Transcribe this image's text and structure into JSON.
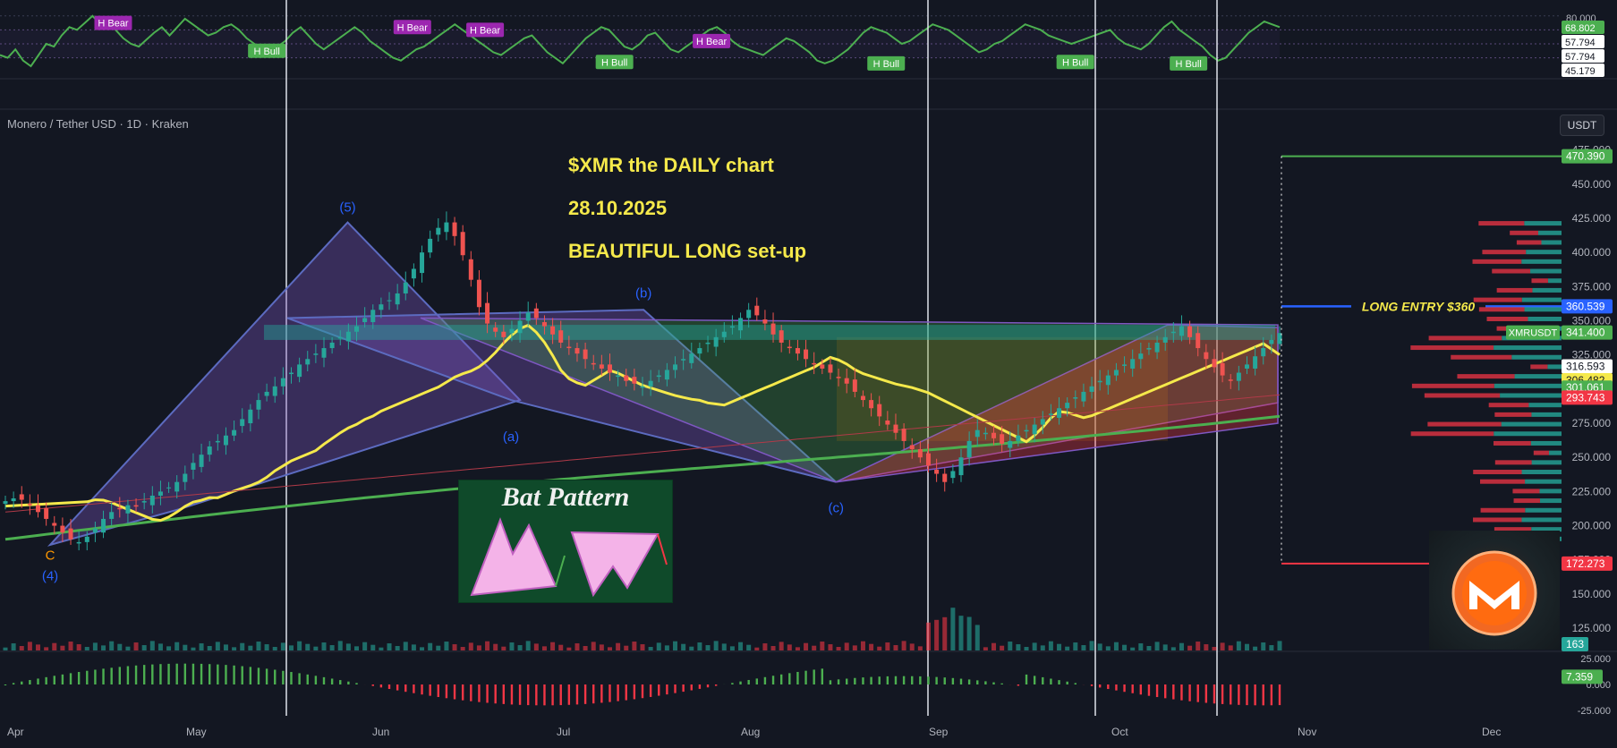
{
  "header": {
    "symbol": "Monero / Tether USD · 1D · Kraken",
    "currency_button": "USDT"
  },
  "annotations": {
    "line1": "$XMR   the DAILY chart",
    "line2": "28.10.2025",
    "line3": "BEAUTIFUL LONG set-up",
    "entry_label": "LONG ENTRY $360",
    "bat_title": "Bat Pattern"
  },
  "colors": {
    "background": "#131722",
    "rsi_line": "#4caf50",
    "bull_badge": "#4caf50",
    "bear_badge": "#9c27b0",
    "up_candle": "#26a69a",
    "down_candle": "#ef5350",
    "ma_yellow": "#f5e94b",
    "ma_green": "#4caf50",
    "entry_blue": "#2962ff",
    "target_green": "#4caf50",
    "stop_red": "#f23645",
    "harmonic_fill": "#7e57c2"
  },
  "chart_data": [
    {
      "type": "line",
      "title": "",
      "panel": "rsi",
      "y_ticks": [
        "80.000"
      ],
      "price_labels": [
        {
          "text": "68.802",
          "color": "#4caf50"
        },
        {
          "text": "57.794",
          "color": "#ffffff"
        },
        {
          "text": "57.794",
          "color": "#ffffff"
        },
        {
          "text": "45.179",
          "color": "#ffffff"
        }
      ],
      "divergence_labels": [
        {
          "text": "H Bear",
          "kind": "bear"
        },
        {
          "text": "H Bull",
          "kind": "bull"
        },
        {
          "text": "H Bear",
          "kind": "bear"
        },
        {
          "text": "H Bear",
          "kind": "bear"
        },
        {
          "text": "H Bull",
          "kind": "bull"
        },
        {
          "text": "H Bear",
          "kind": "bear"
        },
        {
          "text": "H Bull",
          "kind": "bull"
        },
        {
          "text": "H Bull",
          "kind": "bull"
        },
        {
          "text": "H Bull",
          "kind": "bull"
        }
      ],
      "divergence_x": [
        0.07,
        0.165,
        0.255,
        0.3,
        0.38,
        0.44,
        0.548,
        0.665,
        0.735
      ],
      "divergence_level": [
        75,
        55,
        72,
        70,
        47,
        62,
        46,
        47,
        46
      ],
      "ylim": [
        35,
        85
      ],
      "values": [
        52,
        50,
        56,
        48,
        44,
        52,
        60,
        58,
        66,
        72,
        70,
        75,
        80,
        74,
        76,
        70,
        64,
        60,
        58,
        63,
        68,
        72,
        66,
        72,
        78,
        74,
        70,
        66,
        68,
        72,
        74,
        70,
        64,
        60,
        56,
        54,
        58,
        62,
        68,
        72,
        66,
        60,
        56,
        60,
        64,
        68,
        72,
        68,
        62,
        58,
        54,
        50,
        48,
        52,
        56,
        58,
        62,
        66,
        70,
        74,
        70,
        66,
        62,
        58,
        54,
        52,
        56,
        60,
        64,
        66,
        60,
        54,
        50,
        46,
        52,
        58,
        64,
        68,
        72,
        70,
        64,
        58,
        56,
        60,
        66,
        68,
        62,
        56,
        54,
        58,
        62,
        66,
        70,
        72,
        68,
        62,
        58,
        56,
        54,
        52,
        56,
        60,
        64,
        62,
        58,
        54,
        48,
        46,
        48,
        52,
        56,
        62,
        68,
        72,
        70,
        68,
        64,
        60,
        62,
        66,
        70,
        74,
        72,
        70,
        66,
        62,
        58,
        54,
        56,
        60,
        62,
        66,
        70,
        74,
        72,
        70,
        66,
        64,
        62,
        60,
        62,
        64,
        66,
        68,
        70,
        64,
        60,
        58,
        56,
        60,
        66,
        72,
        76,
        70,
        66,
        62,
        58,
        52,
        48,
        50,
        56,
        62,
        68,
        72,
        76,
        74,
        72
      ]
    },
    {
      "type": "candlestick",
      "title": "",
      "panel": "price",
      "x_ticks": [
        "Apr",
        "May",
        "Jun",
        "Jul",
        "Aug",
        "Sep",
        "Oct",
        "Nov",
        "Dec"
      ],
      "y_ticks": [
        "475.000",
        "450.000",
        "425.000",
        "400.000",
        "375.000",
        "350.000",
        "325.000",
        "300.000",
        "275.000",
        "250.000",
        "225.000",
        "200.000",
        "175.000",
        "150.000",
        "125.000"
      ],
      "ylim": [
        110,
        480
      ],
      "price_labels": [
        {
          "text": "470.390",
          "value": 470.39,
          "color": "#4caf50"
        },
        {
          "text": "360.539",
          "value": 360.539,
          "color": "#2962ff"
        },
        {
          "text": "XMRUSDT",
          "value": 341.4,
          "color": "#4caf50"
        },
        {
          "text": "341.400",
          "value": 341.4,
          "color": "#4caf50"
        },
        {
          "text": "316.593",
          "value": 316.593,
          "color": "#131722"
        },
        {
          "text": "306.482",
          "value": 306.482,
          "color": "#f5e94b"
        },
        {
          "text": "301.061",
          "value": 301.061,
          "color": "#4caf50"
        },
        {
          "text": "293.743",
          "value": 293.743,
          "color": "#f23645"
        },
        {
          "text": "172.273",
          "value": 172.273,
          "color": "#f23645"
        }
      ],
      "levels": {
        "target": 470.39,
        "entry": 360.539,
        "stop": 172.273
      },
      "wave_labels": [
        {
          "text": "(5)",
          "x": 0.215,
          "y": 430
        },
        {
          "text": "(b)",
          "x": 0.398,
          "y": 367
        },
        {
          "text": "(a)",
          "x": 0.316,
          "y": 262
        },
        {
          "text": "(c)",
          "x": 0.517,
          "y": 210
        },
        {
          "text": "(4)",
          "x": 0.031,
          "y": 160
        },
        {
          "text": "C",
          "x": 0.031,
          "y": 175
        }
      ],
      "pivots": [
        {
          "x": 0.031,
          "y": 186
        },
        {
          "x": 0.215,
          "y": 422
        },
        {
          "x": 0.316,
          "y": 292
        },
        {
          "x": 0.398,
          "y": 358
        },
        {
          "x": 0.517,
          "y": 232
        }
      ],
      "series": [
        {
          "name": "",
          "values": [
            218,
            220,
            219,
            215,
            210,
            205,
            200,
            195,
            190,
            188,
            192,
            198,
            205,
            210,
            212,
            215,
            214,
            218,
            222,
            225,
            228,
            232,
            238,
            246,
            252,
            258,
            262,
            266,
            270,
            278,
            285,
            292,
            298,
            302,
            308,
            312,
            318,
            322,
            326,
            330,
            334,
            338,
            342,
            346,
            352,
            358,
            362,
            365,
            370,
            378,
            388,
            400,
            410,
            418,
            422,
            412,
            398,
            380,
            360,
            348,
            342,
            338,
            344,
            350,
            356,
            352,
            346,
            340,
            334,
            330,
            326,
            322,
            318,
            315,
            312,
            310,
            306,
            304,
            302,
            306,
            310,
            314,
            318,
            322,
            326,
            330,
            334,
            338,
            342,
            346,
            352,
            358,
            354,
            348,
            340,
            334,
            330,
            326,
            322,
            318,
            315,
            312,
            308,
            304,
            298,
            292,
            286,
            280,
            274,
            268,
            262,
            256,
            250,
            244,
            238,
            232,
            240,
            250,
            262,
            270,
            268,
            264,
            260,
            262,
            266,
            270,
            274,
            278,
            282,
            286,
            290,
            294,
            298,
            302,
            306,
            310,
            314,
            318,
            322,
            326,
            330,
            334,
            338,
            342,
            346,
            338,
            330,
            322,
            316,
            310,
            306,
            312,
            318,
            324,
            330,
            336,
            341
          ]
        }
      ]
    },
    {
      "type": "bar",
      "title": "",
      "panel": "volume",
      "price_labels": [
        {
          "text": "163",
          "color": "#26a69a"
        }
      ],
      "ylim": [
        0,
        160
      ]
    },
    {
      "type": "bar",
      "title": "",
      "panel": "histogram",
      "y_ticks": [
        "25.000",
        "0.000",
        "-25.000"
      ],
      "ylim": [
        -30,
        30
      ],
      "price_labels": [
        {
          "text": "7.359",
          "color": "#4caf50"
        }
      ]
    }
  ]
}
